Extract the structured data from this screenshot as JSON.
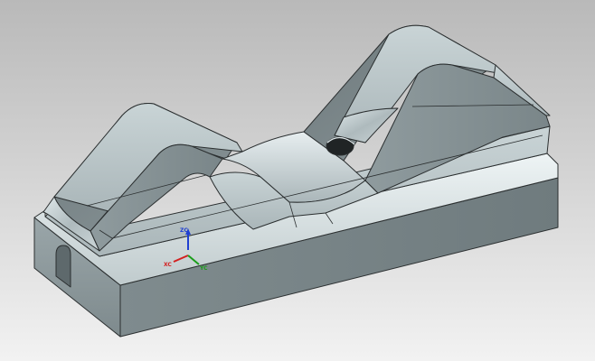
{
  "viewport": {
    "background_top": "#b9b9b9",
    "background_bottom": "#f2f2f2"
  },
  "model": {
    "face_color": "#b7c3c6",
    "edge_color": "#2b2f30"
  },
  "triad": {
    "z_label": "ZC",
    "x_label": "XC",
    "y_label": "YC",
    "z_color": "#1f3fd1",
    "x_color": "#d32020",
    "y_color": "#1a9e1a"
  }
}
